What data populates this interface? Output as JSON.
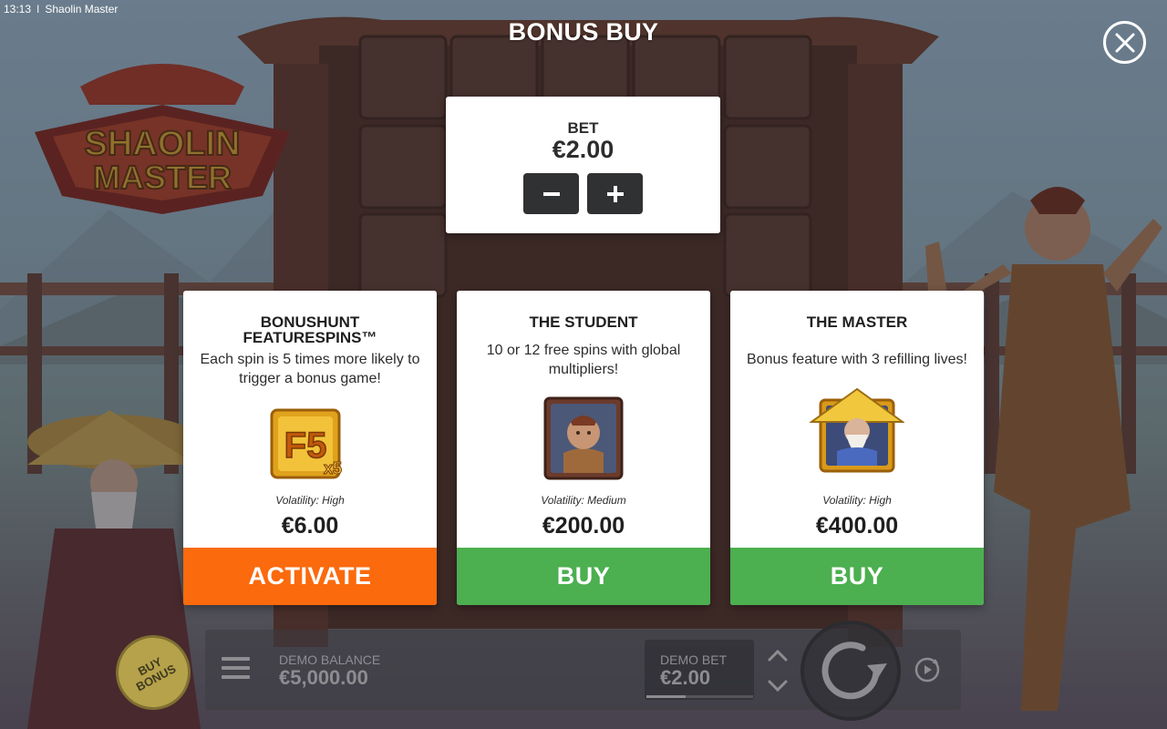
{
  "status_bar": {
    "time": "13:13",
    "separator": "I",
    "app_name": "Shaolin Master"
  },
  "title": "BONUS BUY",
  "bet_panel": {
    "label": "BET",
    "value": "€2.00"
  },
  "cards": [
    {
      "title": "BONUSHUNT FEATURESPINS™",
      "description": "Each spin is 5 times more likely to trigger a bonus game!",
      "volatility": "Volatility: High",
      "price": "€6.00",
      "action": "ACTIVATE",
      "icon": "f5-x5-icon"
    },
    {
      "title": "THE STUDENT",
      "description": "10 or 12 free spins with global multipliers!",
      "volatility": "Volatility: Medium",
      "price": "€200.00",
      "action": "BUY",
      "icon": "student-portrait-icon"
    },
    {
      "title": "THE MASTER",
      "description": "Bonus feature with 3 refilling lives!",
      "volatility": "Volatility: High",
      "price": "€400.00",
      "action": "BUY",
      "icon": "master-portrait-icon"
    }
  ],
  "bottom_bar": {
    "buy_bonus": "BUY BONUS",
    "demo_balance_label": "DEMO BALANCE",
    "demo_balance_value": "€5,000.00",
    "demo_bet_label": "DEMO BET",
    "demo_bet_value": "€2.00",
    "bet_level_fraction": 0.37
  },
  "game_logo_text": "SHAOLIN MASTER",
  "colors": {
    "activate": "#fb6a0d",
    "buy": "#4caf50",
    "panel": "#ffffff",
    "dark_button": "#2f3133"
  }
}
